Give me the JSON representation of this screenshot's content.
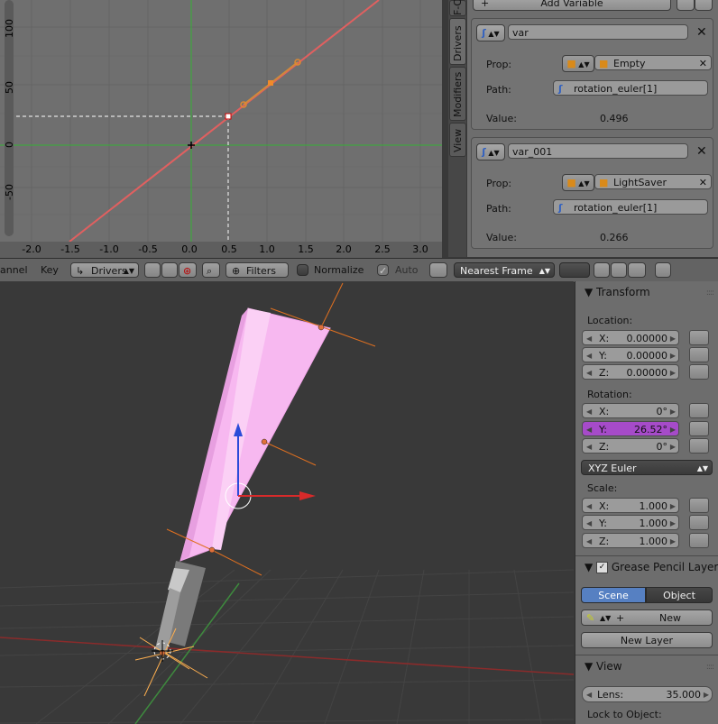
{
  "graph_editor": {
    "x_ticks": [
      "-2.0",
      "-1.5",
      "-1.0",
      "-0.5",
      "0.0",
      "0.5",
      "1.0",
      "1.5",
      "2.0",
      "2.5",
      "3.0"
    ],
    "y_ticks": [
      "100",
      "50",
      "0",
      "-50"
    ],
    "tabs": [
      "F-C",
      "Drivers",
      "Modifiers",
      "View"
    ],
    "add_variable_label": "Add Variable",
    "variables": [
      {
        "name": "var",
        "prop_label": "Prop:",
        "object": "Empty",
        "path_label": "Path:",
        "path": "rotation_euler[1]",
        "value_label": "Value:",
        "value": "0.496"
      },
      {
        "name": "var_001",
        "prop_label": "Prop:",
        "object": "LightSaver",
        "path_label": "Path:",
        "path": "rotation_euler[1]",
        "value_label": "Value:",
        "value": "0.266"
      }
    ]
  },
  "header": {
    "channel_label": "annel",
    "key_label": "Key",
    "mode_label": "Drivers",
    "filters_label": "Filters",
    "normalize_label": "Normalize",
    "auto_label": "Auto",
    "snap_label": "Nearest Frame"
  },
  "properties": {
    "transform_title": "Transform",
    "location_label": "Location:",
    "location": [
      {
        "axis": "X:",
        "value": "0.00000"
      },
      {
        "axis": "Y:",
        "value": "0.00000"
      },
      {
        "axis": "Z:",
        "value": "0.00000"
      }
    ],
    "rotation_label": "Rotation:",
    "rotation": [
      {
        "axis": "X:",
        "value": "0°"
      },
      {
        "axis": "Y:",
        "value": "26.52°"
      },
      {
        "axis": "Z:",
        "value": "0°"
      }
    ],
    "rotation_mode": "XYZ Euler",
    "scale_label": "Scale:",
    "scale": [
      {
        "axis": "X:",
        "value": "1.000"
      },
      {
        "axis": "Y:",
        "value": "1.000"
      },
      {
        "axis": "Z:",
        "value": "1.000"
      }
    ],
    "grease_title": "Grease Pencil Layers",
    "scene_tab": "Scene",
    "object_tab": "Object",
    "new_label": "New",
    "new_layer_label": "New Layer",
    "view_title": "View",
    "lens_label": "Lens:",
    "lens_value": "35.000",
    "lock_label": "Lock to Object:"
  },
  "colors": {
    "curve": "#e06060",
    "highlight_field": "#a64bc9",
    "active_tab": "#5680c2",
    "blade": "#f7b8f0"
  }
}
